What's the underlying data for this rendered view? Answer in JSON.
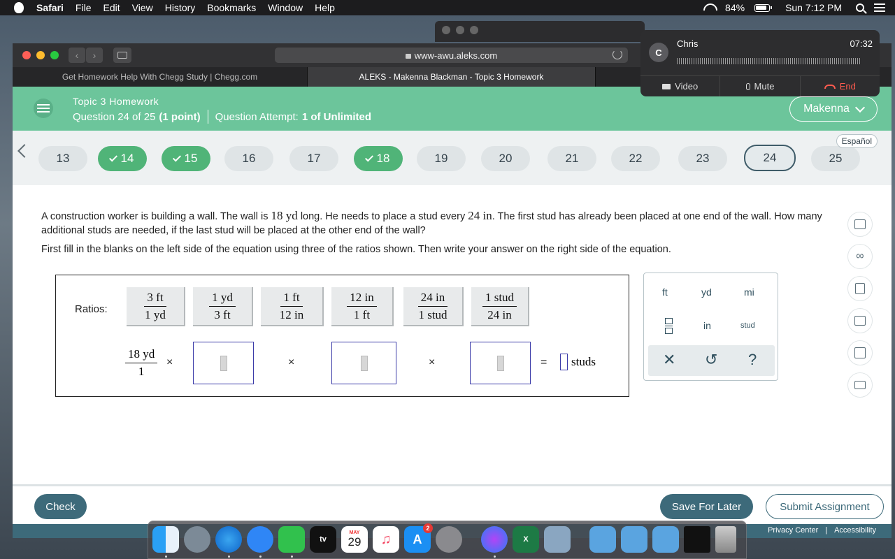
{
  "menubar": {
    "app": "Safari",
    "items": [
      "File",
      "Edit",
      "View",
      "History",
      "Bookmarks",
      "Window",
      "Help"
    ],
    "battery": "84%",
    "clock": "Sun 7:12 PM"
  },
  "browser": {
    "url": "www-awu.aleks.com",
    "tabs": [
      "Get Homework Help With Chegg Study | Chegg.com",
      "ALEKS - Makenna Blackman - Topic 3 Homework"
    ]
  },
  "call": {
    "avatar_initial": "C",
    "name": "Chris",
    "timer": "07:32",
    "video": "Video",
    "mute": "Mute",
    "end": "End"
  },
  "header": {
    "title": "Topic 3 Homework",
    "question_prefix": "Question 24 of 25",
    "points": "(1 point)",
    "attempt_label": "Question Attempt:",
    "attempt_value": "1 of Unlimited",
    "user": "Makenna"
  },
  "questions": {
    "language": "Español",
    "items": [
      {
        "label": "13",
        "state": "plain"
      },
      {
        "label": "14",
        "state": "done"
      },
      {
        "label": "15",
        "state": "done"
      },
      {
        "label": "16",
        "state": "plain"
      },
      {
        "label": "17",
        "state": "plain"
      },
      {
        "label": "18",
        "state": "done"
      },
      {
        "label": "19",
        "state": "plain"
      },
      {
        "label": "20",
        "state": "plain"
      },
      {
        "label": "21",
        "state": "plain"
      },
      {
        "label": "22",
        "state": "plain"
      },
      {
        "label": "23",
        "state": "plain"
      },
      {
        "label": "24",
        "state": "current"
      },
      {
        "label": "25",
        "state": "plain"
      }
    ]
  },
  "problem": {
    "p1a": "A construction worker is building a wall. The wall is ",
    "n1": "18",
    "u1": " yd",
    "p1b": " long. He needs to place a stud every ",
    "n2": "24",
    "u2": " in",
    "p1c": ". The first stud has already been placed at one end of the wall. How many additional studs are needed, if the last stud will be placed at the other end of the wall?",
    "instruction": "First fill in the blanks on the left side of the equation using three of the ratios shown. Then write your answer on the right side of the equation."
  },
  "ratios": {
    "label": "Ratios:",
    "items": [
      {
        "top": "3 ft",
        "bottom": "1 yd"
      },
      {
        "top": "1 yd",
        "bottom": "3 ft"
      },
      {
        "top": "1 ft",
        "bottom": "12 in"
      },
      {
        "top": "12 in",
        "bottom": "1 ft"
      },
      {
        "top": "24 in",
        "bottom": "1 stud"
      },
      {
        "top": "1 stud",
        "bottom": "24 in"
      }
    ]
  },
  "equation": {
    "start_top": "18 yd",
    "start_bottom": "1",
    "times": "×",
    "equals": "=",
    "answer_unit": "studs"
  },
  "keypad": {
    "units": [
      "ft",
      "yd",
      "mi",
      "in",
      "stud"
    ],
    "clear": "✕",
    "undo": "↺",
    "help": "?"
  },
  "bottom": {
    "check": "Check",
    "save": "Save For Later",
    "submit": "Submit Assignment",
    "privacy": "Privacy Center",
    "sep": "|",
    "accessibility": "Accessibility"
  },
  "dock": {
    "tv": "tv",
    "calendar_month": "MAY",
    "calendar_day": "29",
    "appstore_badge": "2",
    "excel": "X"
  }
}
